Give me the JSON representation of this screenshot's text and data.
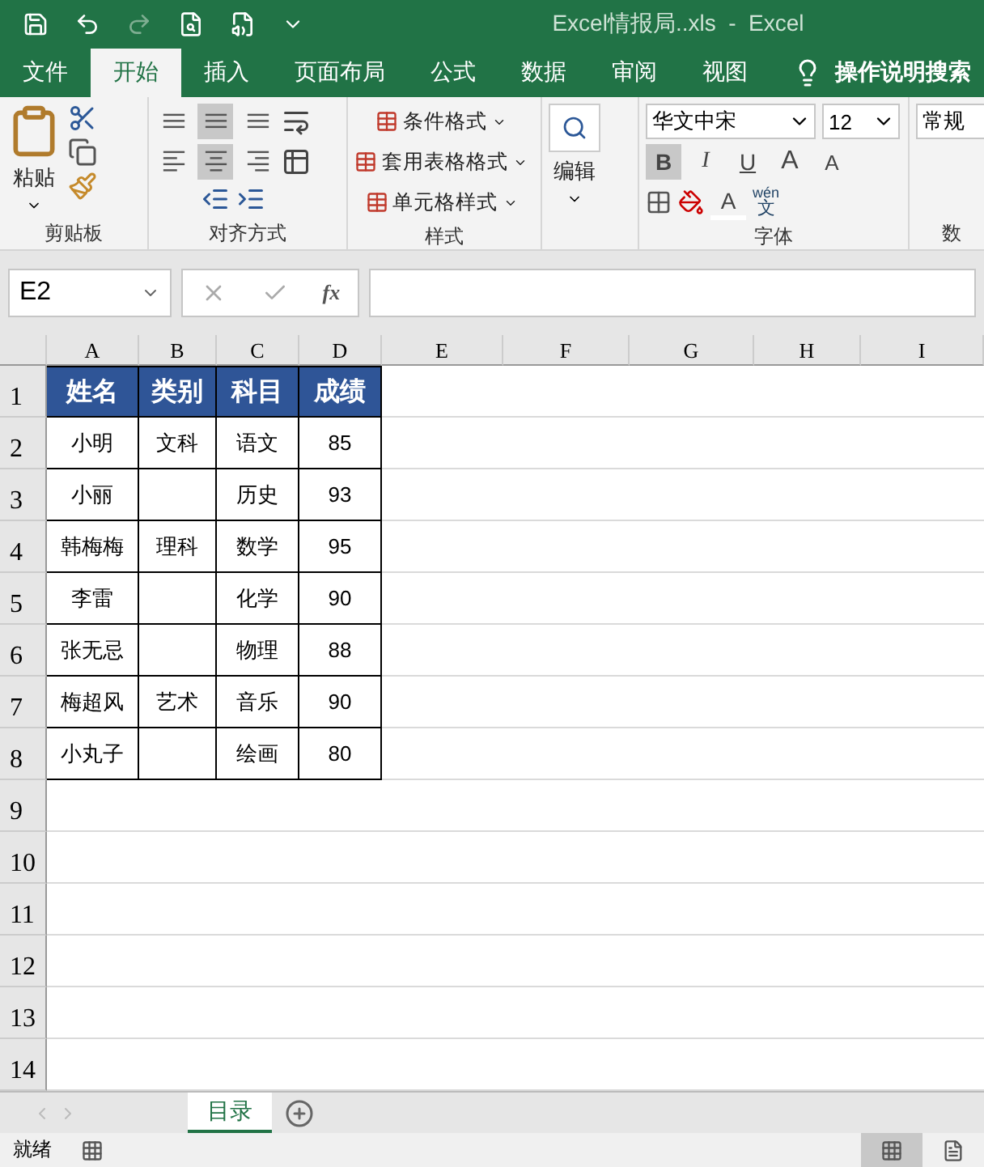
{
  "window": {
    "title": "Excel情报局..xls  -  Excel"
  },
  "ribbon_tabs": [
    {
      "label": "文件",
      "selected": false
    },
    {
      "label": "开始",
      "selected": true
    },
    {
      "label": "插入",
      "selected": false
    },
    {
      "label": "页面布局",
      "selected": false
    },
    {
      "label": "公式",
      "selected": false
    },
    {
      "label": "数据",
      "selected": false
    },
    {
      "label": "审阅",
      "selected": false
    },
    {
      "label": "视图",
      "selected": false
    }
  ],
  "tell_me": "操作说明搜索",
  "clipboard": {
    "paste": "粘贴",
    "group": "剪贴板"
  },
  "alignment": {
    "group": "对齐方式",
    "buttons": [
      {
        "kind": "top",
        "selected": false
      },
      {
        "kind": "middle",
        "selected": true
      },
      {
        "kind": "bottom",
        "selected": false
      },
      {
        "kind": "left",
        "selected": false
      },
      {
        "kind": "center",
        "selected": true
      },
      {
        "kind": "right",
        "selected": false
      }
    ]
  },
  "styles": {
    "items": [
      "条件格式",
      "套用表格格式",
      "单元格样式"
    ],
    "group": "样式"
  },
  "editing": {
    "label": "编辑"
  },
  "font": {
    "name": "华文中宋",
    "size": "12",
    "bold": {
      "label": "B",
      "on": true
    },
    "italic": "I",
    "underline": "U",
    "grow": "A",
    "shrink": "A",
    "font_color": "A",
    "phonetic_top": "wén",
    "phonetic_bottom": "文",
    "group": "字体"
  },
  "number": {
    "format": "常规",
    "group": "数"
  },
  "formula_bar": {
    "name_box": "E2",
    "fx": "fx"
  },
  "columns": [
    "A",
    "B",
    "C",
    "D",
    "E",
    "F",
    "G",
    "H",
    "I"
  ],
  "row_numbers": [
    "1",
    "2",
    "3",
    "4",
    "5",
    "6",
    "7",
    "8",
    "9",
    "10",
    "11",
    "12",
    "13",
    "14"
  ],
  "table": {
    "header": [
      "姓名",
      "类别",
      "科目",
      "成绩"
    ],
    "rows": [
      {
        "name": "小明",
        "category": "文科",
        "subject": "语文",
        "score": "85"
      },
      {
        "name": "小丽",
        "subject": "历史",
        "score": "93"
      },
      {
        "name": "韩梅梅",
        "category": "理科",
        "subject": "数学",
        "score": "95"
      },
      {
        "name": "李雷",
        "subject": "化学",
        "score": "90"
      },
      {
        "name": "张无忌",
        "subject": "物理",
        "score": "88"
      },
      {
        "name": "梅超风",
        "category": "艺术",
        "subject": "音乐",
        "score": "90"
      },
      {
        "name": "小丸子",
        "subject": "绘画",
        "score": "80"
      }
    ]
  },
  "sheet_tabs": [
    {
      "label": "目录",
      "selected": true
    }
  ],
  "status": "就绪"
}
